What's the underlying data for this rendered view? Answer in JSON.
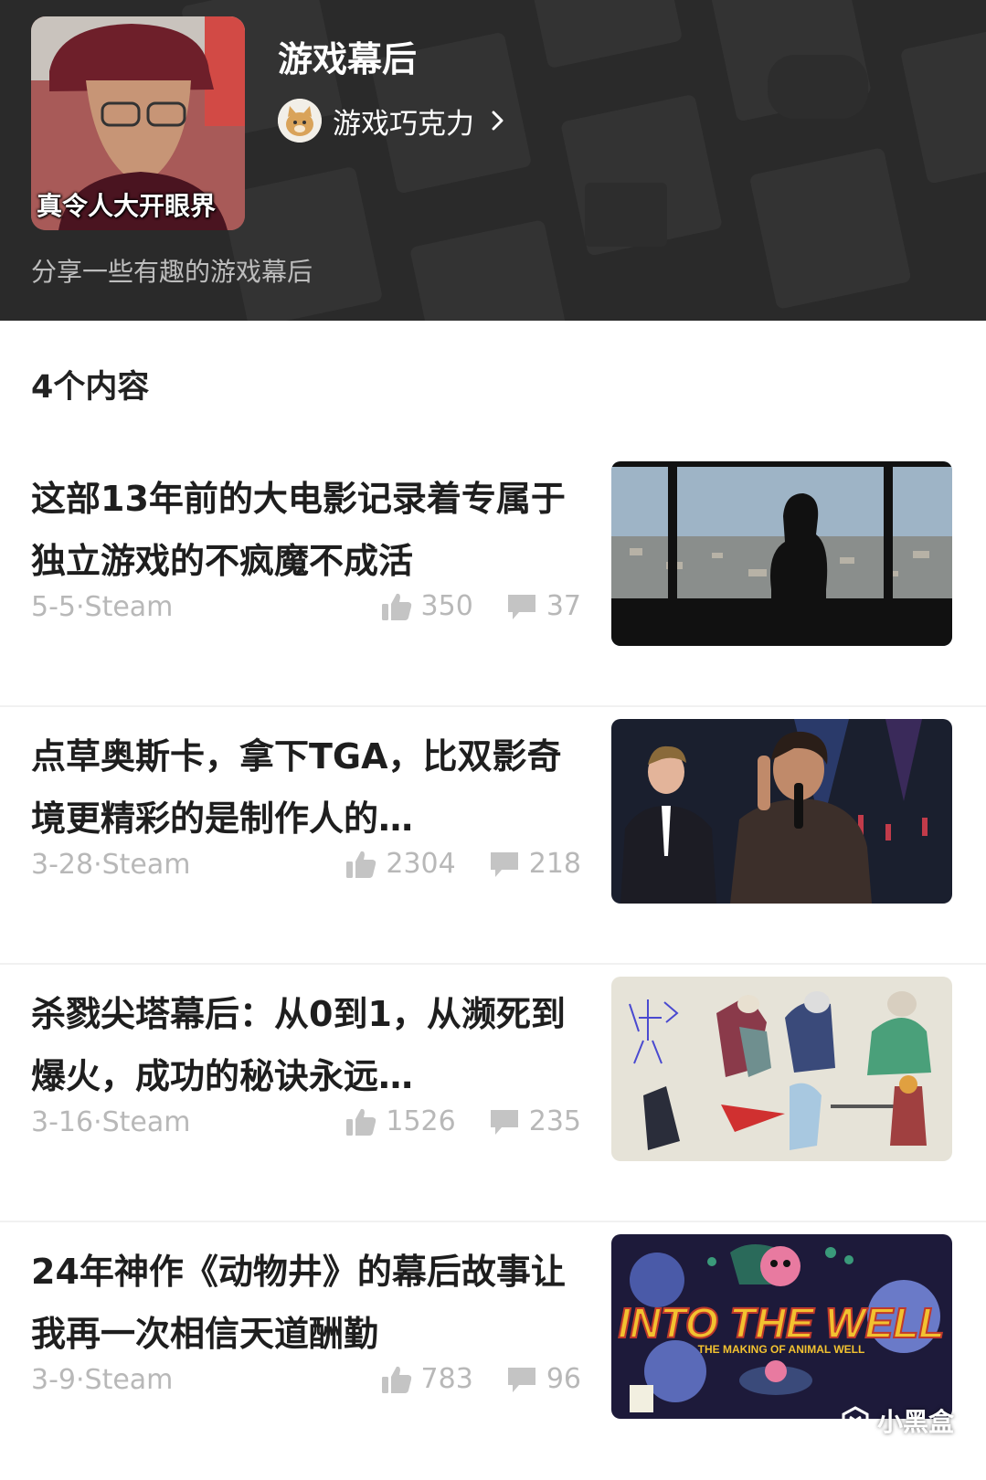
{
  "header": {
    "cover_caption": "真令人大开眼界",
    "title": "游戏幕后",
    "author_name": "游戏巧克力",
    "description": "分享一些有趣的游戏幕后",
    "background_color": "#2a2a2a"
  },
  "content_count": "4个内容",
  "articles": [
    {
      "title": "这部13年前的大电影记录着专属于独立游戏的不疯魔不成活",
      "meta": "5-5·Steam",
      "likes": "350",
      "comments": "37",
      "thumb_icon": "silhouette-city-window"
    },
    {
      "title": "点草奥斯卡，拿下TGA，比双影奇境更精彩的是制作人的…",
      "meta": "3-28·Steam",
      "likes": "2304",
      "comments": "218",
      "thumb_icon": "award-stage-photo"
    },
    {
      "title": "杀戮尖塔幕后：从0到1，从濒死到爆火，成功的秘诀永远…",
      "meta": "3-16·Steam",
      "likes": "1526",
      "comments": "235",
      "thumb_icon": "character-sketches"
    },
    {
      "title": "24年神作《动物井》的幕后故事让我再一次相信天道酬勤",
      "meta": "3-9·Steam",
      "likes": "783",
      "comments": "96",
      "thumb_icon": "animal-well-poster",
      "thumb_text": "INTO THE WELL",
      "thumb_subtext": "THE MAKING OF ANIMAL WELL"
    }
  ],
  "watermark": "小黑盒",
  "colors": {
    "meta_gray": "#b8b8b8",
    "title_dark": "#1e1e1e"
  }
}
